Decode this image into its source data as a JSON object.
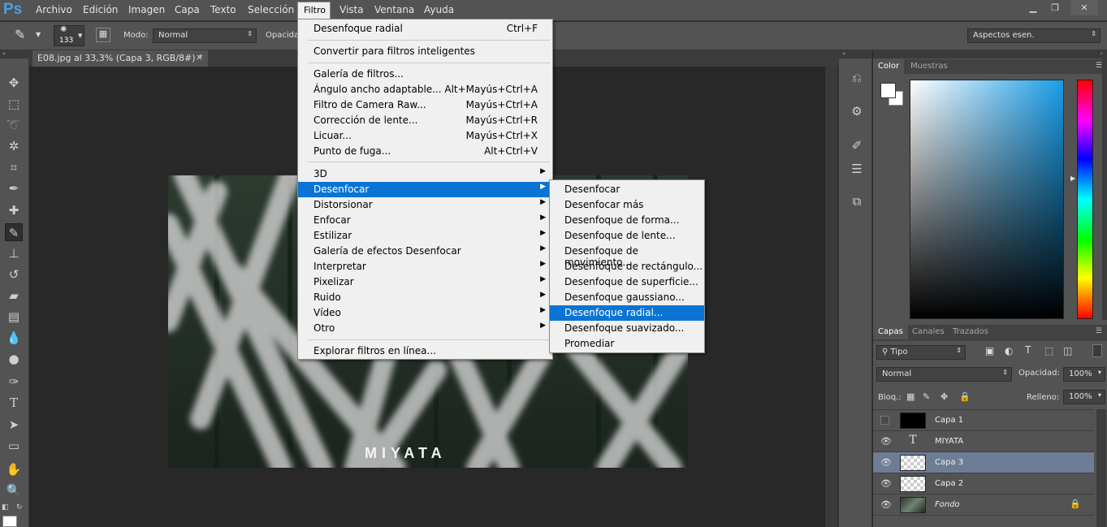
{
  "app": {
    "logo": "Ps",
    "window_controls": {
      "minimize": "▁",
      "restore": "❐",
      "close": "✕"
    }
  },
  "menubar": {
    "items": [
      "Archivo",
      "Edición",
      "Imagen",
      "Capa",
      "Texto",
      "Selección",
      "Filtro",
      "Vista",
      "Ventana",
      "Ayuda"
    ],
    "active": "Filtro"
  },
  "options": {
    "brush_size": "133",
    "mode_label": "Modo:",
    "mode_value": "Normal",
    "opacity_label": "Opacidad",
    "workspace": "Aspectos esen."
  },
  "document": {
    "tab_title": "E08.jpg al 33,3% (Capa 3, RGB/8#) *",
    "close": "×",
    "watermark_text": "MIYATA"
  },
  "filter_menu": {
    "items": [
      {
        "label": "Desenfoque radial",
        "shortcut": "Ctrl+F"
      },
      {
        "label": "Convertir para filtros inteligentes"
      },
      {
        "label": "Galería de filtros..."
      },
      {
        "label": "Ángulo ancho adaptable...",
        "shortcut": "Alt+Mayús+Ctrl+A"
      },
      {
        "label": "Filtro de Camera Raw...",
        "shortcut": "Mayús+Ctrl+A"
      },
      {
        "label": "Corrección de lente...",
        "shortcut": "Mayús+Ctrl+R"
      },
      {
        "label": "Licuar...",
        "shortcut": "Mayús+Ctrl+X"
      },
      {
        "label": "Punto de fuga...",
        "shortcut": "Alt+Ctrl+V"
      },
      {
        "label": "3D",
        "submenu": true
      },
      {
        "label": "Desenfocar",
        "submenu": true,
        "highlighted": true
      },
      {
        "label": "Distorsionar",
        "submenu": true
      },
      {
        "label": "Enfocar",
        "submenu": true
      },
      {
        "label": "Estilizar",
        "submenu": true
      },
      {
        "label": "Galería de efectos Desenfocar",
        "submenu": true
      },
      {
        "label": "Interpretar",
        "submenu": true
      },
      {
        "label": "Pixelizar",
        "submenu": true
      },
      {
        "label": "Ruido",
        "submenu": true
      },
      {
        "label": "Vídeo",
        "submenu": true
      },
      {
        "label": "Otro",
        "submenu": true
      },
      {
        "label": "Explorar filtros en línea..."
      }
    ]
  },
  "blur_submenu": {
    "items": [
      "Desenfocar",
      "Desenfocar más",
      "Desenfoque de forma...",
      "Desenfoque de lente...",
      "Desenfoque de movimiento...",
      "Desenfoque de rectángulo...",
      "Desenfoque de superficie...",
      "Desenfoque gaussiano...",
      "Desenfoque radial...",
      "Desenfoque suavizado...",
      "Promediar"
    ],
    "highlighted": "Desenfoque radial..."
  },
  "color_panel": {
    "tabs": [
      "Color",
      "Muestras"
    ],
    "foreground": "#ffffff",
    "background": "#ffffff",
    "hue_color": "#1a9de8"
  },
  "layers_panel": {
    "tabs": [
      "Capas",
      "Canales",
      "Trazados"
    ],
    "filter_kind": "Tipo",
    "blend_mode": "Normal",
    "opacity_label": "Opacidad:",
    "opacity_value": "100%",
    "lock_label": "Bloq.:",
    "fill_label": "Relleno:",
    "fill_value": "100%",
    "layers": [
      {
        "name": "Capa 1",
        "visible": false,
        "thumb": "black"
      },
      {
        "name": "MIYATA",
        "visible": true,
        "thumb": "text",
        "thumb_glyph": "T"
      },
      {
        "name": "Capa 3",
        "visible": true,
        "thumb": "transparent",
        "selected": true
      },
      {
        "name": "Capa 2",
        "visible": true,
        "thumb": "transparent"
      },
      {
        "name": "Fondo",
        "visible": true,
        "thumb": "photo",
        "locked": true
      }
    ]
  }
}
